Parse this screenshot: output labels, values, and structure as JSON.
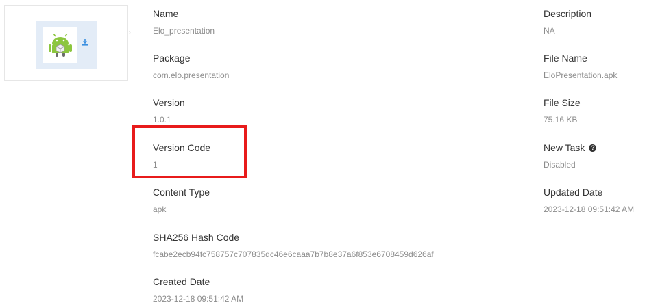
{
  "left_column": [
    {
      "key": "name",
      "label": "Name",
      "value": "Elo_presentation"
    },
    {
      "key": "package",
      "label": "Package",
      "value": "com.elo.presentation"
    },
    {
      "key": "version",
      "label": "Version",
      "value": "1.0.1"
    },
    {
      "key": "version_code",
      "label": "Version Code",
      "value": "1"
    },
    {
      "key": "content_type",
      "label": "Content Type",
      "value": "apk"
    },
    {
      "key": "sha256",
      "label": "SHA256 Hash Code",
      "value": "fcabe2ecb94fc758757c707835dc46e6caaa7b7b8e37a6f853e6708459d626af"
    },
    {
      "key": "created_date",
      "label": "Created Date",
      "value": "2023-12-18 09:51:42 AM"
    }
  ],
  "right_column": [
    {
      "key": "description",
      "label": "Description",
      "value": "NA"
    },
    {
      "key": "file_name",
      "label": "File Name",
      "value": "EloPresentation.apk"
    },
    {
      "key": "file_size",
      "label": "File Size",
      "value": "75.16 KB"
    },
    {
      "key": "new_task",
      "label": "New Task",
      "value": "Disabled",
      "icon": "help-icon"
    },
    {
      "key": "updated_date",
      "label": "Updated Date",
      "value": "2023-12-18 09:51:42 AM"
    }
  ],
  "icons": {
    "thumbnail": "android-apk-icon",
    "download": "download-icon",
    "expand": "chevron-right-icon"
  },
  "colors": {
    "highlight_box": "#e81b1b",
    "label_text": "#333333",
    "value_text": "#8c8c8c",
    "thumbnail_bg": "#e3ecf7",
    "android_green": "#8cc63e",
    "download_blue": "#3b8fe0"
  }
}
